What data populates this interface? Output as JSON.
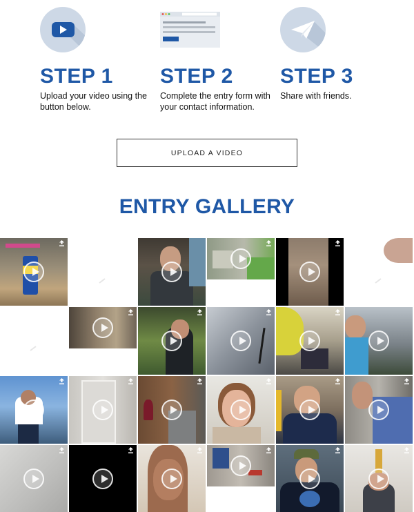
{
  "steps": [
    {
      "title": "STEP 1",
      "description": "Upload your video using the button below.",
      "icon": "youtube-play-icon"
    },
    {
      "title": "STEP 2",
      "description": "Complete the entry form with your contact information.",
      "icon": "form-icon"
    },
    {
      "title": "STEP 3",
      "description": "Share with friends.",
      "icon": "paper-plane-icon"
    }
  ],
  "upload_button": {
    "label": "UPLOAD A VIDEO"
  },
  "gallery": {
    "title": "ENTRY GALLERY"
  },
  "colors": {
    "brand_blue": "#1f58a6",
    "icon_circle": "#cdd8e6",
    "youtube_blue": "#1f58a6"
  }
}
